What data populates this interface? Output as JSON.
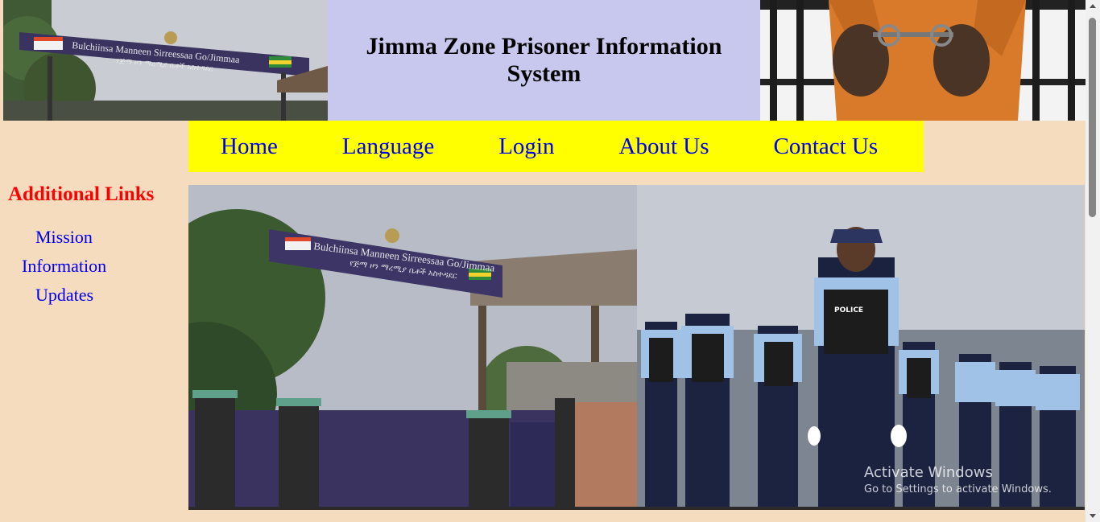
{
  "header": {
    "title": "Jimma Zone Prisoner Information System",
    "left_image": {
      "sign_text": "Bulchiinsa Manneen Sirreessaa Go/Jimmaa",
      "sign_subtext": "የጅማ ዞን ማረሚያ ቤቶች አስተዳደር"
    },
    "right_image": "handcuffed-prisoner-image"
  },
  "nav": {
    "items": [
      {
        "label": "Home"
      },
      {
        "label": "Language"
      },
      {
        "label": "Login"
      },
      {
        "label": "About Us"
      },
      {
        "label": "Contact Us"
      }
    ]
  },
  "sidebar": {
    "heading": "Additional Links",
    "links": [
      {
        "label": "Mission"
      },
      {
        "label": "Information"
      },
      {
        "label": "Updates"
      }
    ]
  },
  "banner": {
    "left_image": {
      "sign_text": "Bulchiinsa Manneen Sirreessaa Go/Jimmaa",
      "sign_subtext": "የጅማ ዞን ማረሚያ ቤቶች አስተዳደር"
    },
    "right_image": {
      "badge_text": "POLICE"
    }
  },
  "watermark": {
    "line1": "Activate Windows",
    "line2": "Go to Settings to activate Windows."
  },
  "colors": {
    "page_bg": "#f5dcbe",
    "title_bg": "#c8c8ee",
    "nav_bg": "#ffff00",
    "link": "#0000ee",
    "sidebar_heading": "#ff0000"
  }
}
